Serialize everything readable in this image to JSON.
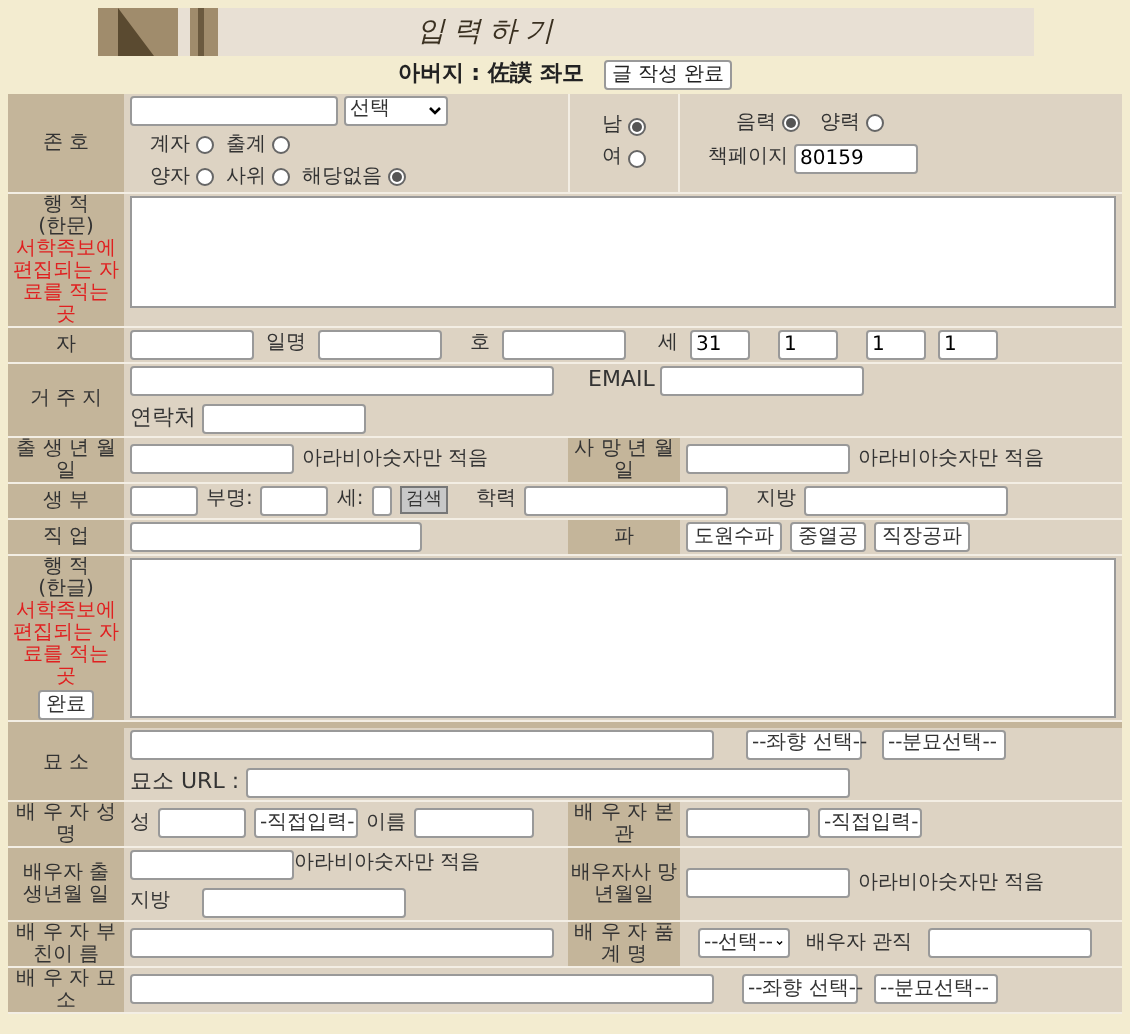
{
  "header": {
    "banner_title": "입력하기",
    "father_label": "아버지 :",
    "father_name": "佐謨 좌모",
    "submit_button": "글 작성 완료"
  },
  "identity": {
    "label": "존 호",
    "select": "선택",
    "relations": [
      {
        "label": "계자",
        "selected": false
      },
      {
        "label": "출계",
        "selected": false
      },
      {
        "label": "양자",
        "selected": false
      },
      {
        "label": "사위",
        "selected": false
      },
      {
        "label": "해당없음",
        "selected": true
      }
    ],
    "gender": [
      {
        "label": "남",
        "selected": true
      },
      {
        "label": "여",
        "selected": false
      }
    ],
    "calendar": [
      {
        "label": "음력",
        "selected": true
      },
      {
        "label": "양력",
        "selected": false
      }
    ],
    "page_label": "책페이지",
    "page_value": "80159"
  },
  "record_hanmun": {
    "label": "행 적",
    "sublabel": "(한문)",
    "note": "서학족보에 편집되는 자료를 적는 곳"
  },
  "names": {
    "label": "자",
    "alias_label": "일명",
    "ho_label": "호",
    "generation_label": "세",
    "generation_value": "31",
    "fields": [
      "1",
      "1",
      "1"
    ]
  },
  "residence": {
    "label": "거 주 지",
    "email_label": "EMAIL",
    "contact_label": "연락처"
  },
  "dates": {
    "birth_label": "출 생 년 월 일",
    "birth_hint": "아라비아숫자만 적음",
    "death_label": "사 망 년 월 일",
    "death_hint": "아라비아숫자만 적음"
  },
  "father": {
    "label": "생 부",
    "name_label": "부명:",
    "generation_label": "세:",
    "search_button": "검색",
    "education_label": "학력",
    "region_label": "지방"
  },
  "occupation": {
    "label": "직 업",
    "branch_label": "파",
    "branches": [
      "도원수파",
      "중열공",
      "직장공파"
    ]
  },
  "record_hangul": {
    "label": "행 적",
    "sublabel": "(한글)",
    "note": "서학족보에 편집되는 자료를 적는 곳",
    "done_button": "완료"
  },
  "grave": {
    "label": "묘 소",
    "direction_select": "--좌향 선택--",
    "grave_select": "--분묘선택--",
    "url_label": "묘소 URL :"
  },
  "spouse_name": {
    "label": "배 우 자 성 명",
    "surname_label": "성",
    "surname_select": "-직접입력-",
    "given_label": "이름",
    "origin_label": "배 우 자 본 관",
    "origin_select": "-직접입력-"
  },
  "spouse_dates": {
    "birth_label": "배우자 출 생년월 일",
    "birth_hint": "아라비아숫자만 적음",
    "region_label": "지방",
    "death_label": "배우자사 망년월일",
    "death_hint": "아라비아숫자만 적음"
  },
  "spouse_father": {
    "label": "배 우 자 부친이 름",
    "rank_label": "배 우 자 품 계 명",
    "rank_select": "--선택--",
    "office_label": "배우자 관직"
  },
  "spouse_grave": {
    "label": "배 우 자 묘 소",
    "direction_select": "--좌향 선택--",
    "grave_select": "--분묘선택--"
  }
}
